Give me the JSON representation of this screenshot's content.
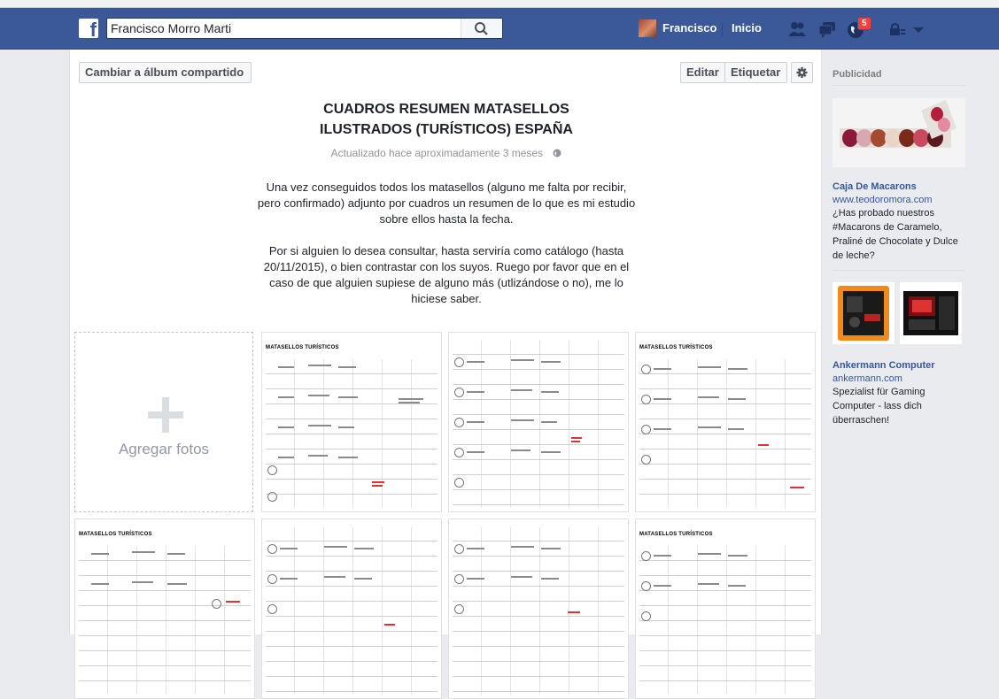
{
  "topbar": {
    "logo": "f",
    "search_value": "Francisco Morro Marti",
    "user_name": "Francisco",
    "home_label": "Inicio",
    "notifications_count": "5"
  },
  "album": {
    "shared_button": "Cambiar a álbum compartido",
    "edit_button": "Editar",
    "tag_button": "Etiquetar",
    "settings_icon": "gear-icon",
    "title_line1": "CUADROS RESUMEN MATASELLOS",
    "title_line2": "ILUSTRADOS (TURÍSTICOS) ESPAÑA",
    "updated": "Actualizado hace aproximadamente 3 meses",
    "description_p1": "Una vez conseguidos todos los matasellos (alguno me falta por recibir, pero confirmado) adjunto por cuadros un resumen de lo que es mi estudio sobre ellos hasta la fecha.",
    "description_p2": "Por si alguien lo desea consultar, hasta serviría como catálogo (hasta 20/11/2015), o bien contrastar con los suyos. Ruego por favor que en el caso de que alguien supiese de alguno más (utlizándose o no), me lo hiciese saber.",
    "add_photos": "Agregar fotos",
    "photo_sheet_title": "MATASELLOS TURÍSTICOS"
  },
  "sidebar": {
    "heading": "Publicidad",
    "ad1": {
      "title": "Caja De Macarons",
      "url": "www.teodoromora.com",
      "text": "¿Has probado nuestros #Macarons de Caramelo, Praliné de Chocolate y Dulce de leche?"
    },
    "ad2": {
      "title": "Ankermann Computer",
      "url": "ankermann.com",
      "text": "Spezialist für Gaming Computer - lass dich überraschen!"
    }
  },
  "colors": {
    "brand": "#3b5998",
    "link": "#365899",
    "badge": "#fa3e3e"
  }
}
